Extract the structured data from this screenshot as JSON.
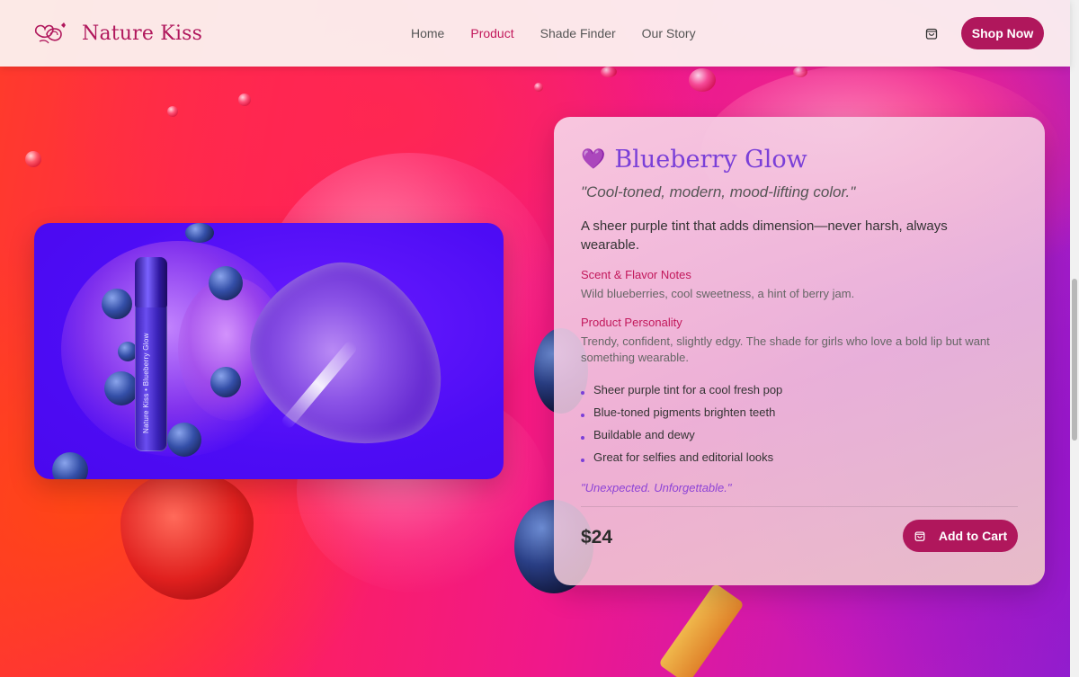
{
  "brand": {
    "name": "Nature Kiss",
    "logo_icon": "rose-logo-icon"
  },
  "nav": {
    "links": [
      "Home",
      "Product",
      "Shade Finder",
      "Our Story"
    ],
    "active": "Product",
    "cart_icon": "shopping-bag-icon",
    "cta": "Shop Now"
  },
  "product": {
    "image_label": "Nature Kiss • Blueberry Glow",
    "heart_icon": "💜",
    "title": "Blueberry Glow",
    "tagline": "\"Cool-toned, modern, mood-lifting color.\"",
    "description": "A sheer purple tint that adds dimension—never harsh, always wearable.",
    "scent_label": "Scent & Flavor Notes",
    "scent_text": "Wild blueberries, cool sweetness, a hint of berry jam.",
    "personality_label": "Product Personality",
    "personality_text": "Trendy, confident, slightly edgy. The shade for girls who love a bold lip but want something wearable.",
    "features": [
      "Sheer purple tint for a cool fresh pop",
      "Blue-toned pigments brighten teeth",
      "Buildable and dewy",
      "Great for selfies and editorial looks"
    ],
    "closing": "\"Unexpected. Unforgettable.\"",
    "price": "$24",
    "add_to_cart": "Add to Cart"
  },
  "colors": {
    "brand": "#b0175c",
    "accent_purple": "#7a3fd8",
    "section_label": "#c2185b"
  }
}
